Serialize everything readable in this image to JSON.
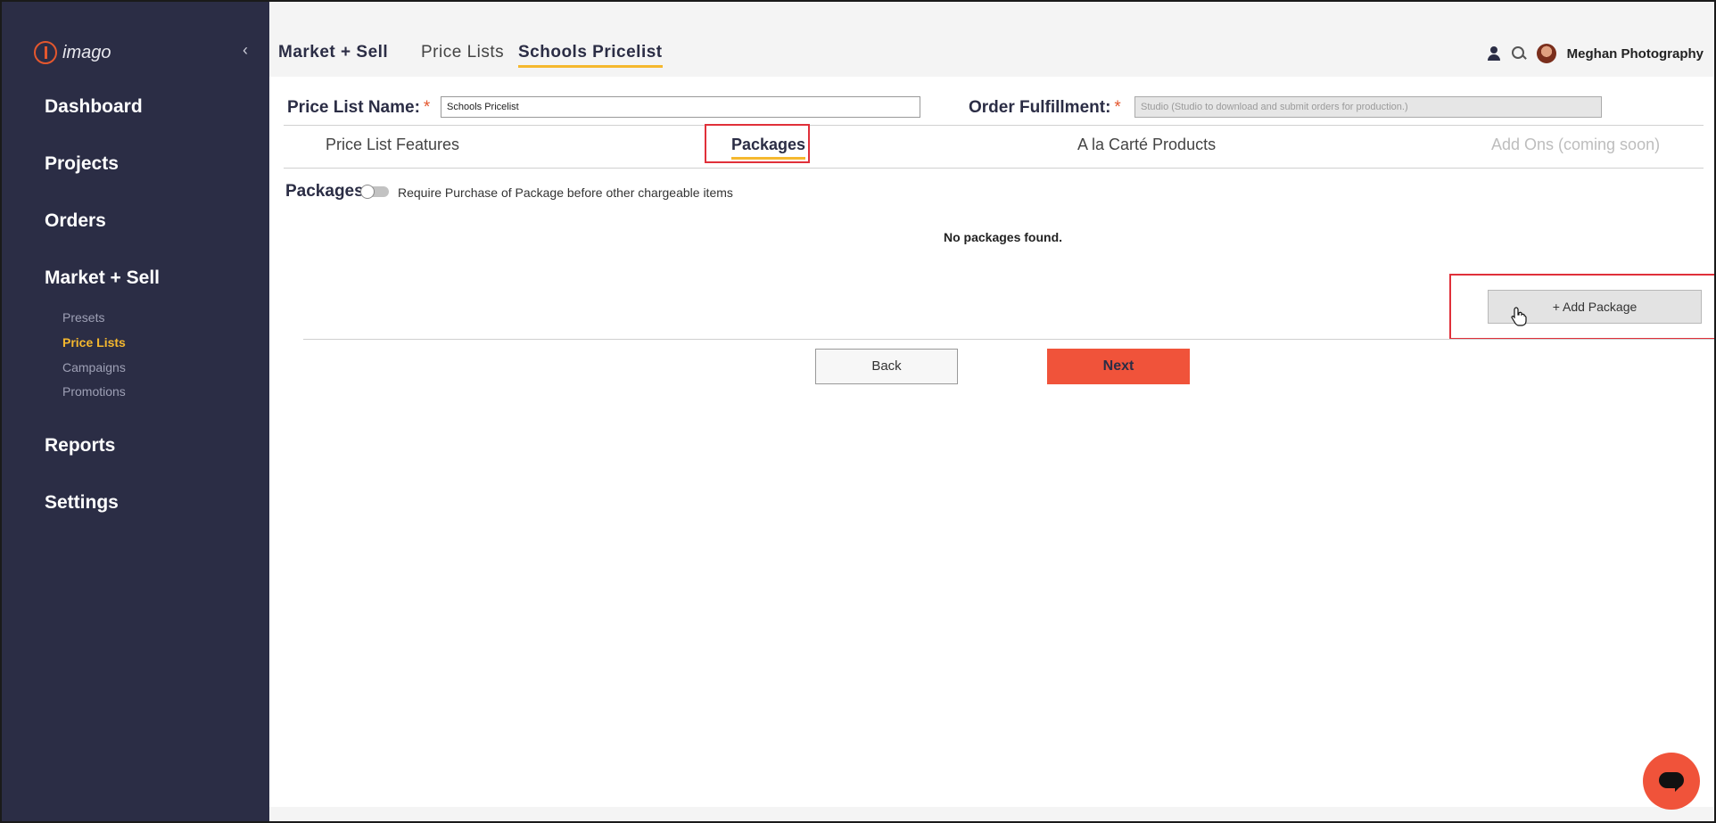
{
  "app": {
    "logo_text": "imago",
    "collapse_glyph": "‹"
  },
  "sidebar": {
    "items": [
      {
        "label": "Dashboard"
      },
      {
        "label": "Projects"
      },
      {
        "label": "Orders"
      },
      {
        "label": "Market + Sell"
      },
      {
        "label": "Reports"
      },
      {
        "label": "Settings"
      }
    ],
    "subitems": [
      {
        "label": "Presets"
      },
      {
        "label": "Price Lists",
        "active": true
      },
      {
        "label": "Campaigns"
      },
      {
        "label": "Promotions"
      }
    ]
  },
  "header": {
    "breadcrumb": [
      "Market + Sell",
      "Price Lists",
      "Schools Pricelist"
    ],
    "account_name": "Meghan Photography"
  },
  "form": {
    "price_list_name_label": "Price List Name:",
    "price_list_name_value": "Schools Pricelist",
    "order_fulfillment_label": "Order Fulfillment:",
    "order_fulfillment_value": "Studio (Studio to download and submit orders for production.)",
    "required_mark": "*"
  },
  "tabs": [
    {
      "label": "Price List Features"
    },
    {
      "label": "Packages",
      "active": true
    },
    {
      "label": "A la Carté Products"
    },
    {
      "label": "Add Ons (coming soon)",
      "disabled": true
    }
  ],
  "packages": {
    "label": "Packages",
    "toggle_label": "Require Purchase of Package before other chargeable items",
    "toggle_on": false,
    "empty_text": "No packages found.",
    "add_button": "+ Add Package"
  },
  "actions": {
    "back": "Back",
    "next": "Next"
  },
  "colors": {
    "sidebar": "#2b2d45",
    "accent": "#f5b82e",
    "primary": "#f0533a",
    "highlight": "#e0303a"
  },
  "icons": [
    "user-icon",
    "search-icon",
    "chat-icon",
    "hand-cursor-icon"
  ]
}
